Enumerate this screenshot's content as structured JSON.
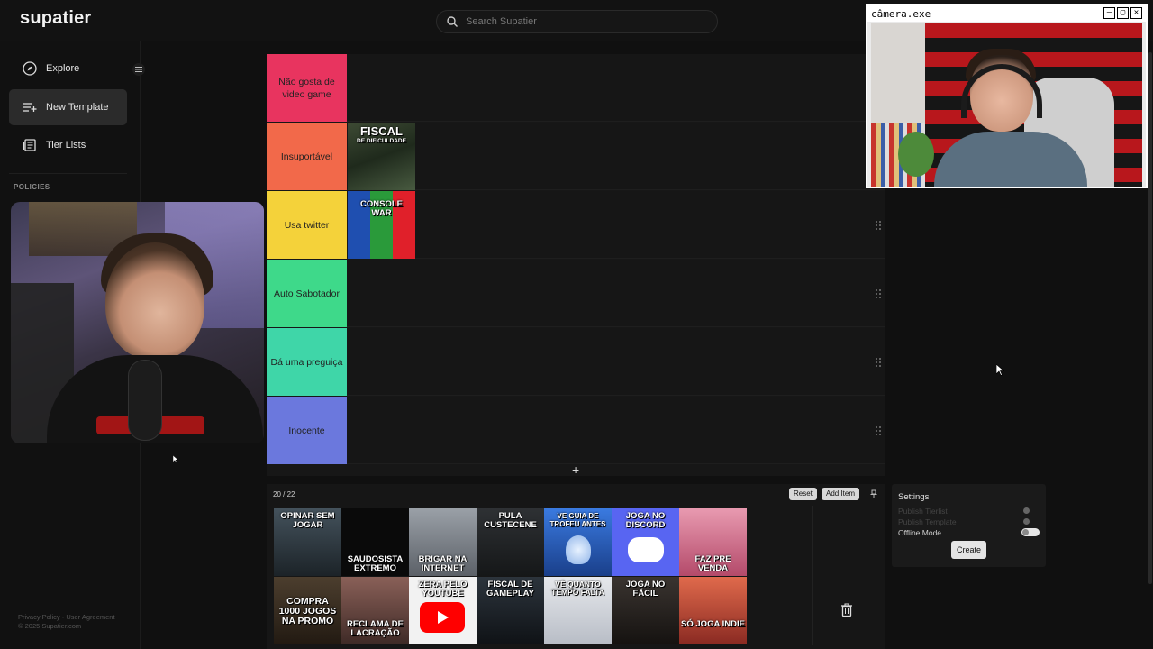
{
  "app": {
    "logo": "supatier"
  },
  "search": {
    "placeholder": "Search Supatier"
  },
  "sidebar": {
    "items": [
      {
        "label": "Explore",
        "icon": "compass-icon"
      },
      {
        "label": "New Template",
        "icon": "list-add-icon",
        "active": true
      },
      {
        "label": "Tier Lists",
        "icon": "newspaper-icon"
      }
    ],
    "section_label": "POLICIES",
    "footer_links": "Privacy Policy · User Agreement",
    "copyright": "© 2025 Supatier.com"
  },
  "camera_window": {
    "title": "câmera.exe",
    "buttons": [
      "–",
      "▢",
      "✕"
    ]
  },
  "tiers": [
    {
      "label": "Não gosta de video game",
      "color": "#e8345f",
      "items": []
    },
    {
      "label": "Insuportável",
      "color": "#f2694a",
      "items": [
        {
          "text": "FISCAL",
          "subtext": "DE DIFICULDADE"
        }
      ]
    },
    {
      "label": "Usa twitter",
      "color": "#f4d23a",
      "items": [
        {
          "text": "CONSOLE WAR"
        }
      ]
    },
    {
      "label": "Auto Sabotador",
      "color": "#3ed98a",
      "items": []
    },
    {
      "label": "Dá uma preguiça",
      "color": "#3fd6a8",
      "items": []
    },
    {
      "label": "Inocente",
      "color": "#6b78dd",
      "items": []
    }
  ],
  "tier_add_symbol": "+",
  "pool": {
    "count": "20 / 22",
    "reset_label": "Reset",
    "add_item_label": "Add Item",
    "items": [
      {
        "text": "OPINAR SEM JOGAR",
        "bg": "#2d3a44"
      },
      {
        "text": "SAUDOSISTA EXTREMO",
        "bg": "#0a0a0a"
      },
      {
        "text": "BRIGAR NA INTERNET",
        "bg": "#8a8f96"
      },
      {
        "text": "PULA CUSTECENE",
        "bg": "#222426"
      },
      {
        "text": "VE GUIA DE TROFEU ANTES",
        "bg": "#2a63c9"
      },
      {
        "text": "JOGA NO DISCORD",
        "bg": "#5865f2"
      },
      {
        "text": "FAZ PRE VENDA",
        "bg": "#c86a8a"
      },
      {
        "text": "COMPRA 1000 JOGOS NA PROMO",
        "bg": "#3b3024"
      },
      {
        "text": "RECLAMA DE LACRAÇÃO",
        "bg": "#6a4a44"
      },
      {
        "text": "ZERA PELO YOUTUBE",
        "bg": "#f2f2f2"
      },
      {
        "text": "FISCAL DE GAMEPLAY",
        "bg": "#1e242a"
      },
      {
        "text": "VÊ QUANTO TEMPO FALTA",
        "bg": "#dcdfe4"
      },
      {
        "text": "JOGA NO FÁCIL",
        "bg": "#2a2624"
      },
      {
        "text": "SÓ JOGA INDIE",
        "bg": "#c4463a"
      }
    ]
  },
  "settings": {
    "title": "Settings",
    "options": [
      "Publish Tierlist",
      "Publish Template",
      "Offline Mode"
    ],
    "create_label": "Create"
  },
  "colors": {
    "accent": "#e8345f",
    "bg": "#101010",
    "panel": "#171717"
  }
}
